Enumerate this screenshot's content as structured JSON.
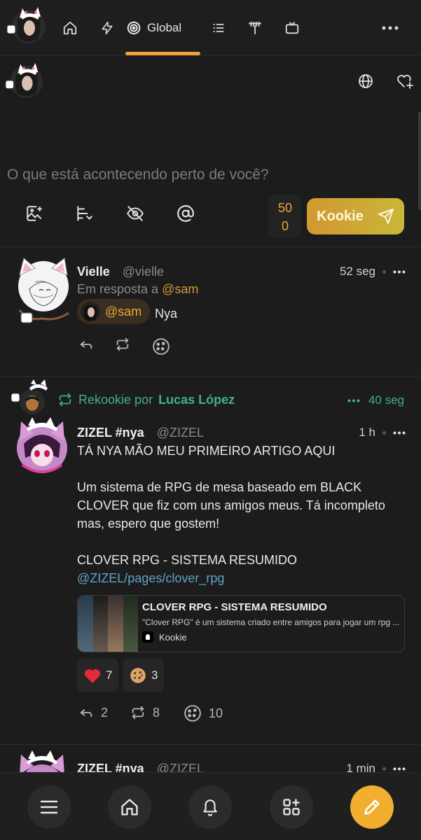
{
  "nav": {
    "global_label": "Global",
    "icons": [
      "home-icon",
      "bolt-icon",
      "global-spiral-icon",
      "list-icon",
      "antenna-icon",
      "tv-icon",
      "more-icon"
    ]
  },
  "composer": {
    "placeholder": "O que está acontecendo perto de você?",
    "counter_line1": "50",
    "counter_line2": "0",
    "send_label": "Kookie"
  },
  "posts": [
    {
      "name": "Vielle",
      "handle": "@vielle",
      "time": "52 seg",
      "reply_prefix": "Em resposta a",
      "reply_mention": "@sam",
      "chip_mention": "@sam",
      "text": "Nya"
    },
    {
      "rekookie_prefix": "Rekookie por",
      "rekookie_user": "Lucas López",
      "rekookie_time": "40 seg",
      "name": "ZIZEL #nya",
      "handle": "@ZIZEL",
      "time": "1 h",
      "line1": "TÁ NYA MÃO MEU PRIMEIRO ARTIGO AQUI",
      "paragraph": "Um sistema de RPG de mesa baseado em BLACK CLOVER que fiz com uns amigos meus. Tá incompleto mas, espero que gostem!",
      "article_title": "CLOVER RPG - SISTEMA RESUMIDO",
      "link": "@ZIZEL/pages/clover_rpg",
      "card": {
        "title": "CLOVER RPG - SISTEMA RESUMIDO",
        "description": "\"Clover RPG\" é um sistema criado entre amigos para jogar um rpg ...",
        "site": "Kookie"
      },
      "reactions": [
        {
          "icon": "heart-icon",
          "count": "7"
        },
        {
          "icon": "cookie-icon",
          "count": "3"
        }
      ],
      "actions": {
        "replies": "2",
        "rekookies": "8",
        "cookies": "10"
      }
    },
    {
      "name": "ZIZEL #nya",
      "handle": "@ZIZEL",
      "time": "1 min"
    }
  ],
  "colors": {
    "accent": "#f0a23a",
    "rekookie": "#3fb08a",
    "link": "#5ea3c9",
    "background": "#1c1c1c"
  }
}
